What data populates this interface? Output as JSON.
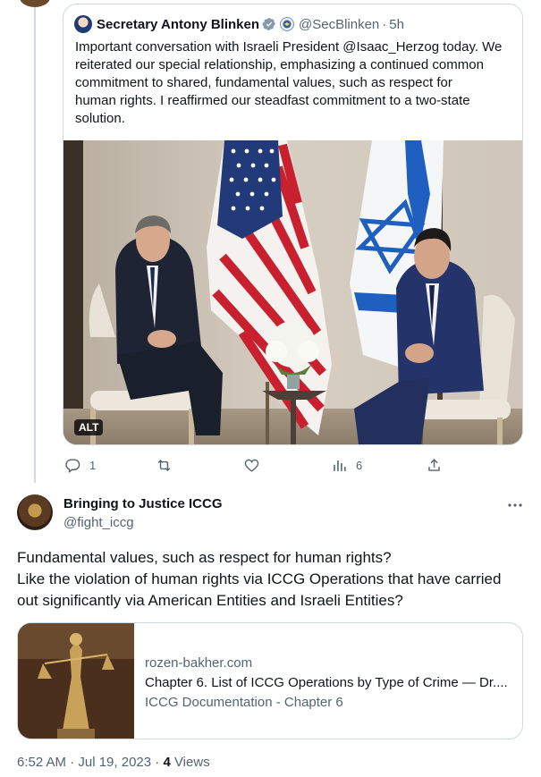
{
  "quoted_tweet": {
    "author_name": "Secretary Antony Blinken",
    "handle": "@SecBlinken",
    "separator": "·",
    "time": "5h",
    "text_lines": [
      "Important conversation with Israeli President @Isaac_Herzog today. We",
      "reiterated our special relationship, emphasizing a continued common",
      "commitment to shared, fundamental values, such as respect for",
      "human rights. I reaffirmed our steadfast commitment to a two-state",
      "solution."
    ],
    "alt_badge": "ALT"
  },
  "actions": {
    "reply_count": "1",
    "retweet_count": "",
    "like_count": "",
    "views_count": "6"
  },
  "reply": {
    "author_name": "Bringing to Justice ICCG",
    "handle": "@fight_iccg",
    "text_lines": [
      "Fundamental values, such as respect for human rights?",
      "Like the violation of human rights via ICCG Operations that have carried",
      "out significantly via American Entities and Israeli Entities?"
    ]
  },
  "link_card": {
    "domain": "rozen-bakher.com",
    "title": "Chapter 6. List of ICCG Operations by Type of Crime — Dr....",
    "description": "ICCG Documentation - Chapter 6"
  },
  "meta": {
    "time": "6:52 AM · Jul 19, 2023 · ",
    "views_count": "4",
    "views_label": " Views"
  },
  "colors": {
    "verified_blue": "#1d9bf0",
    "secondary_text": "#536471",
    "border": "#cfd9de"
  }
}
